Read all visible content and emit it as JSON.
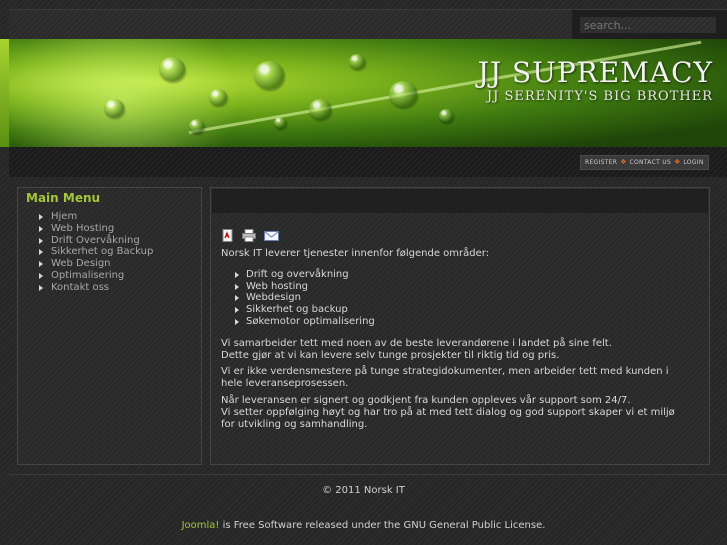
{
  "search": {
    "placeholder": "search..."
  },
  "header": {
    "title": "JJ SUPREMACY",
    "subtitle": "JJ SERENITY'S BIG BROTHER"
  },
  "toplinks": [
    "Register",
    "Contact us",
    "Login"
  ],
  "main_menu": {
    "title": "Main Menu",
    "items": [
      "Hjem",
      "Web Hosting",
      "Drift Overvåkning",
      "Sikkerhet og Backup",
      "Web Design",
      "Optimalisering",
      "Kontakt oss"
    ]
  },
  "article": {
    "icons": [
      "pdf-icon",
      "print-icon",
      "email-icon"
    ],
    "intro": "Norsk IT leverer tjenester innenfor følgende områder:",
    "services": [
      "Drift og overvåkning",
      "Web hosting",
      "Webdesign",
      "Sikkerhet og backup",
      "Søkemotor optimalisering"
    ],
    "p1a": "Vi samarbeider tett med noen av de beste leverandørene i landet på sine felt.",
    "p1b": "Dette gjør at vi kan levere selv tunge prosjekter til riktig tid og pris.",
    "p2": "Vi er ikke verdensmestere på tunge strategidokumenter, men arbeider tett med kunden i hele leveranseprosessen.",
    "p3a": "Når leveransen er signert og godkjent fra kunden oppleves vår support som 24/7.",
    "p3b": "Vi setter oppfølging høyt og har tro på at med tett dialog og god support skaper vi et miljø for utvikling og samhandling."
  },
  "footer": {
    "copyright": "© 2011 Norsk IT",
    "license_link": "Joomla!",
    "license_text": " is Free Software released under the GNU General Public License."
  },
  "colors": {
    "accent": "#a4c639",
    "separator": "#e07020",
    "background": "#2a2a2a"
  }
}
